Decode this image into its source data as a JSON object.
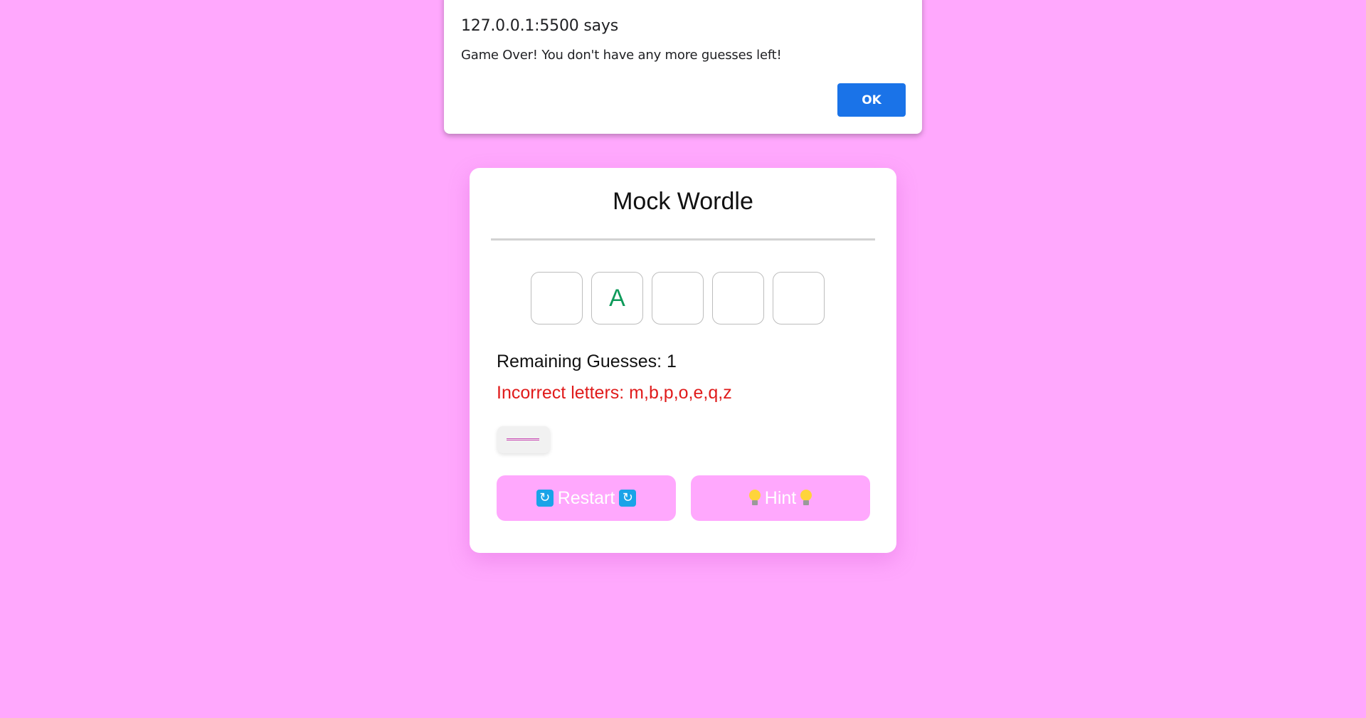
{
  "alert": {
    "origin": "127.0.0.1:5500 says",
    "message": "Game Over! You don't have any more guesses left!",
    "ok_label": "OK"
  },
  "game": {
    "title": "Mock Wordle",
    "tiles": [
      "",
      "A",
      "",
      "",
      ""
    ],
    "remaining": "Remaining Guesses: 1",
    "incorrect": "Incorrect letters: m,b,p,o,e,q,z",
    "guess_input_value": "",
    "restart_label": "Restart",
    "hint_label": "Hint"
  },
  "colors": {
    "background": "#ffa8fd",
    "correct_letter": "#0e9a5a",
    "incorrect_text": "#e01b1b",
    "ok_button": "#1a73e8",
    "restart_icon": "#1aa3e8",
    "hint_icon": "#ffd43b"
  },
  "icons": {
    "restart": "counterclockwise-arrows-button",
    "hint": "light-bulb"
  }
}
